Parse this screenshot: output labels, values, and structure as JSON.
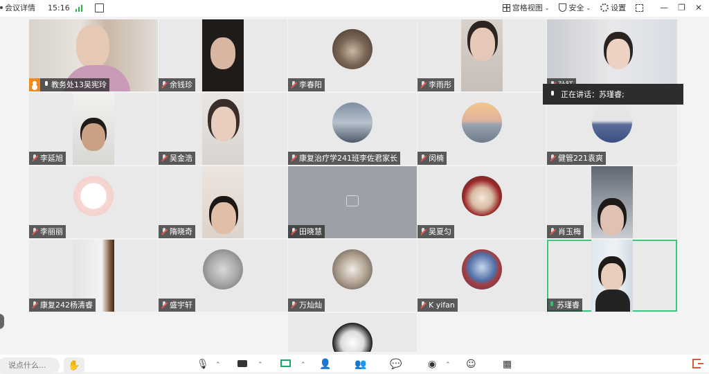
{
  "topbar": {
    "meeting_details": "会议详情",
    "time": "15:16",
    "grid_view": "宫格视图",
    "security": "安全",
    "settings": "设置"
  },
  "participants": [
    {
      "name": "教务处13吴宪玲",
      "host": true,
      "mic": "on"
    },
    {
      "name": "余钱珍",
      "mic": "off"
    },
    {
      "name": "李春阳",
      "mic": "off"
    },
    {
      "name": "李雨彤",
      "mic": "off"
    },
    {
      "name": "孙钰",
      "mic": "off"
    },
    {
      "name": "李延旭",
      "mic": "off"
    },
    {
      "name": "吴金浩",
      "mic": "off"
    },
    {
      "name": "康复治疗学241班李佐君家长",
      "mic": "off"
    },
    {
      "name": "闵楠",
      "mic": "off"
    },
    {
      "name": "健管221袁爽",
      "mic": "off"
    },
    {
      "name": "李丽丽",
      "mic": "off"
    },
    {
      "name": "隋晓奇",
      "mic": "off"
    },
    {
      "name": "田晓慧",
      "mic": "off"
    },
    {
      "name": "吴夏匀",
      "mic": "off"
    },
    {
      "name": "肖玉梅",
      "mic": "off"
    },
    {
      "name": "康复242杨清睿",
      "mic": "off"
    },
    {
      "name": "盛宇轩",
      "mic": "off"
    },
    {
      "name": "万灿灿",
      "mic": "off"
    },
    {
      "name": "K yifan",
      "mic": "off"
    },
    {
      "name": "苏瑾睿",
      "mic": "speaking"
    }
  ],
  "speaking_banner": "正在讲话：苏瑾睿;",
  "bottombar": {
    "chat_placeholder": "说点什么..."
  },
  "colors": {
    "speaker_border": "#3bc47b",
    "host_badge": "#f08a1c",
    "leave": "#e0563a"
  }
}
